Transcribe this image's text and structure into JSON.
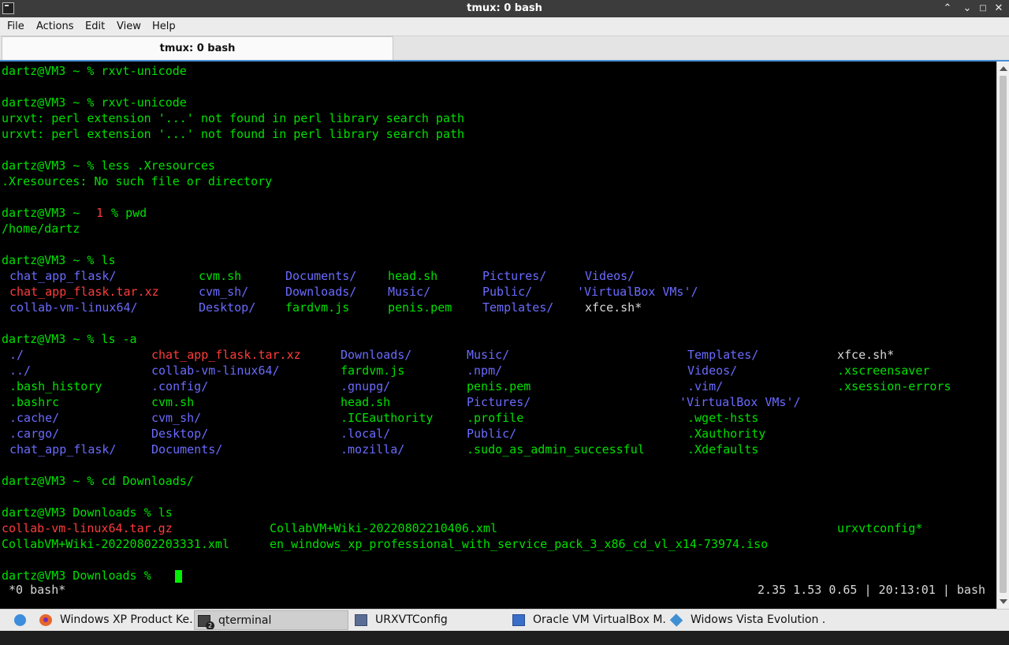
{
  "window": {
    "title": "tmux: 0 bash"
  },
  "menu": [
    "File",
    "Actions",
    "Edit",
    "View",
    "Help"
  ],
  "tab": {
    "label": "tmux: 0 bash"
  },
  "colors": {
    "green": "#00e000",
    "red": "#ff3b3b",
    "blue": "#6b6bff",
    "white": "#d8d8d8",
    "cursor": "#00ee00",
    "status": "#d8d8d8",
    "background": "#000000"
  },
  "terminal_lines": [
    {
      "row": 0,
      "tokens": [
        {
          "col": 0,
          "text": "dartz@VM3 ~ % rxvt-unicode",
          "color": "green"
        }
      ]
    },
    {
      "row": 2,
      "tokens": [
        {
          "col": 0,
          "text": "dartz@VM3 ~ % rxvt-unicode",
          "color": "green"
        }
      ]
    },
    {
      "row": 3,
      "tokens": [
        {
          "col": 0,
          "text": "urxvt: perl extension '...' not found in perl library search path",
          "color": "green"
        }
      ]
    },
    {
      "row": 4,
      "tokens": [
        {
          "col": 0,
          "text": "urxvt: perl extension '...' not found in perl library search path",
          "color": "green"
        }
      ]
    },
    {
      "row": 6,
      "tokens": [
        {
          "col": 0,
          "text": "dartz@VM3 ~ % less .Xresources",
          "color": "green"
        }
      ]
    },
    {
      "row": 7,
      "tokens": [
        {
          "col": 0,
          "text": ".Xresources: No such file or directory",
          "color": "green"
        }
      ]
    },
    {
      "row": 9,
      "tokens": [
        {
          "col": 0,
          "text": "dartz@VM3 ~ ",
          "color": "green"
        },
        {
          "col": 12,
          "text": "1",
          "color": "red"
        },
        {
          "col": 13,
          "text": " % pwd",
          "color": "green"
        }
      ]
    },
    {
      "row": 10,
      "tokens": [
        {
          "col": 0,
          "text": "/home/dartz",
          "color": "green"
        }
      ]
    },
    {
      "row": 12,
      "tokens": [
        {
          "col": 0,
          "text": "dartz@VM3 ~ % ls",
          "color": "green"
        }
      ]
    },
    {
      "row": 13,
      "tokens": [
        {
          "col": 1,
          "text": "chat_app_flask/",
          "color": "blue"
        },
        {
          "col": 25,
          "text": "cvm.sh",
          "color": "green"
        },
        {
          "col": 36,
          "text": "Documents/",
          "color": "blue"
        },
        {
          "col": 49,
          "text": "head.sh",
          "color": "green"
        },
        {
          "col": 61,
          "text": "Pictures/",
          "color": "blue"
        },
        {
          "col": 74,
          "text": "Videos/",
          "color": "blue"
        }
      ]
    },
    {
      "row": 14,
      "tokens": [
        {
          "col": 1,
          "text": "chat_app_flask.tar.xz",
          "color": "red"
        },
        {
          "col": 25,
          "text": "cvm_sh/",
          "color": "blue"
        },
        {
          "col": 36,
          "text": "Downloads/",
          "color": "blue"
        },
        {
          "col": 49,
          "text": "Music/",
          "color": "blue"
        },
        {
          "col": 61,
          "text": "Public/",
          "color": "blue"
        },
        {
          "col": 73,
          "text": "'VirtualBox VMs'/",
          "color": "blue"
        }
      ]
    },
    {
      "row": 15,
      "tokens": [
        {
          "col": 1,
          "text": "collab-vm-linux64/",
          "color": "blue"
        },
        {
          "col": 25,
          "text": "Desktop/",
          "color": "blue"
        },
        {
          "col": 36,
          "text": "fardvm.js",
          "color": "green"
        },
        {
          "col": 49,
          "text": "penis.pem",
          "color": "green"
        },
        {
          "col": 61,
          "text": "Templates/",
          "color": "blue"
        },
        {
          "col": 74,
          "text": "xfce.sh*",
          "color": "white"
        }
      ]
    },
    {
      "row": 17,
      "tokens": [
        {
          "col": 0,
          "text": "dartz@VM3 ~ % ls -a",
          "color": "green"
        }
      ]
    },
    {
      "row": 18,
      "tokens": [
        {
          "col": 1,
          "text": "./",
          "color": "blue"
        },
        {
          "col": 19,
          "text": "chat_app_flask.tar.xz",
          "color": "red"
        },
        {
          "col": 43,
          "text": "Downloads/",
          "color": "blue"
        },
        {
          "col": 59,
          "text": "Music/",
          "color": "blue"
        },
        {
          "col": 87,
          "text": "Templates/",
          "color": "blue"
        },
        {
          "col": 106,
          "text": "xfce.sh*",
          "color": "white"
        }
      ]
    },
    {
      "row": 19,
      "tokens": [
        {
          "col": 1,
          "text": "../",
          "color": "blue"
        },
        {
          "col": 19,
          "text": "collab-vm-linux64/",
          "color": "blue"
        },
        {
          "col": 43,
          "text": "fardvm.js",
          "color": "green"
        },
        {
          "col": 59,
          "text": ".npm/",
          "color": "blue"
        },
        {
          "col": 87,
          "text": "Videos/",
          "color": "blue"
        },
        {
          "col": 106,
          "text": ".xscreensaver",
          "color": "green"
        }
      ]
    },
    {
      "row": 20,
      "tokens": [
        {
          "col": 1,
          "text": ".bash_history",
          "color": "green"
        },
        {
          "col": 19,
          "text": ".config/",
          "color": "blue"
        },
        {
          "col": 43,
          "text": ".gnupg/",
          "color": "blue"
        },
        {
          "col": 59,
          "text": "penis.pem",
          "color": "green"
        },
        {
          "col": 87,
          "text": ".vim/",
          "color": "blue"
        },
        {
          "col": 106,
          "text": ".xsession-errors",
          "color": "green"
        }
      ]
    },
    {
      "row": 21,
      "tokens": [
        {
          "col": 1,
          "text": ".bashrc",
          "color": "green"
        },
        {
          "col": 19,
          "text": "cvm.sh",
          "color": "green"
        },
        {
          "col": 43,
          "text": "head.sh",
          "color": "green"
        },
        {
          "col": 59,
          "text": "Pictures/",
          "color": "blue"
        },
        {
          "col": 86,
          "text": "'VirtualBox VMs'/",
          "color": "blue"
        }
      ]
    },
    {
      "row": 22,
      "tokens": [
        {
          "col": 1,
          "text": ".cache/",
          "color": "blue"
        },
        {
          "col": 19,
          "text": "cvm_sh/",
          "color": "blue"
        },
        {
          "col": 43,
          "text": ".ICEauthority",
          "color": "green"
        },
        {
          "col": 59,
          "text": ".profile",
          "color": "green"
        },
        {
          "col": 87,
          "text": ".wget-hsts",
          "color": "green"
        }
      ]
    },
    {
      "row": 23,
      "tokens": [
        {
          "col": 1,
          "text": ".cargo/",
          "color": "blue"
        },
        {
          "col": 19,
          "text": "Desktop/",
          "color": "blue"
        },
        {
          "col": 43,
          "text": ".local/",
          "color": "blue"
        },
        {
          "col": 59,
          "text": "Public/",
          "color": "blue"
        },
        {
          "col": 87,
          "text": ".Xauthority",
          "color": "green"
        }
      ]
    },
    {
      "row": 24,
      "tokens": [
        {
          "col": 1,
          "text": "chat_app_flask/",
          "color": "blue"
        },
        {
          "col": 19,
          "text": "Documents/",
          "color": "blue"
        },
        {
          "col": 43,
          "text": ".mozilla/",
          "color": "blue"
        },
        {
          "col": 59,
          "text": ".sudo_as_admin_successful",
          "color": "green"
        },
        {
          "col": 87,
          "text": ".Xdefaults",
          "color": "green"
        }
      ]
    },
    {
      "row": 26,
      "tokens": [
        {
          "col": 0,
          "text": "dartz@VM3 ~ % cd Downloads/",
          "color": "green"
        }
      ]
    },
    {
      "row": 28,
      "tokens": [
        {
          "col": 0,
          "text": "dartz@VM3 Downloads % ls",
          "color": "green"
        }
      ]
    },
    {
      "row": 29,
      "tokens": [
        {
          "col": 0,
          "text": "collab-vm-linux64.tar.gz",
          "color": "red"
        },
        {
          "col": 34,
          "text": "CollabVM+Wiki-20220802210406.xml",
          "color": "green"
        },
        {
          "col": 106,
          "text": "urxvtconfig*",
          "color": "green"
        }
      ]
    },
    {
      "row": 30,
      "tokens": [
        {
          "col": 0,
          "text": "CollabVM+Wiki-20220802203331.xml",
          "color": "green"
        },
        {
          "col": 34,
          "text": "en_windows_xp_professional_with_service_pack_3_x86_cd_vl_x14-73974.iso",
          "color": "green"
        }
      ]
    },
    {
      "row": 32,
      "cursor_col": 22,
      "tokens": [
        {
          "col": 0,
          "text": "dartz@VM3 Downloads % ",
          "color": "green"
        }
      ]
    }
  ],
  "tmux_status": {
    "window_label": " *0 bash*",
    "right": "2.35 1.53 0.65 | 20:13:01 | bash"
  },
  "taskbar": {
    "launcher_icon": "app-menu-icon",
    "tasks": [
      {
        "label": "Windows XP Product Ke...",
        "icon": "firefox-icon",
        "active": false
      },
      {
        "label": "qterminal",
        "icon": "terminal-icon",
        "active": true
      },
      {
        "label": "URXVTConfig",
        "icon": "window-icon",
        "active": false
      },
      {
        "label": "Oracle VM VirtualBox M...",
        "icon": "virtualbox-icon",
        "active": false
      },
      {
        "label": "Widows Vista Evolution ...",
        "icon": "vista-icon",
        "active": false
      }
    ]
  }
}
